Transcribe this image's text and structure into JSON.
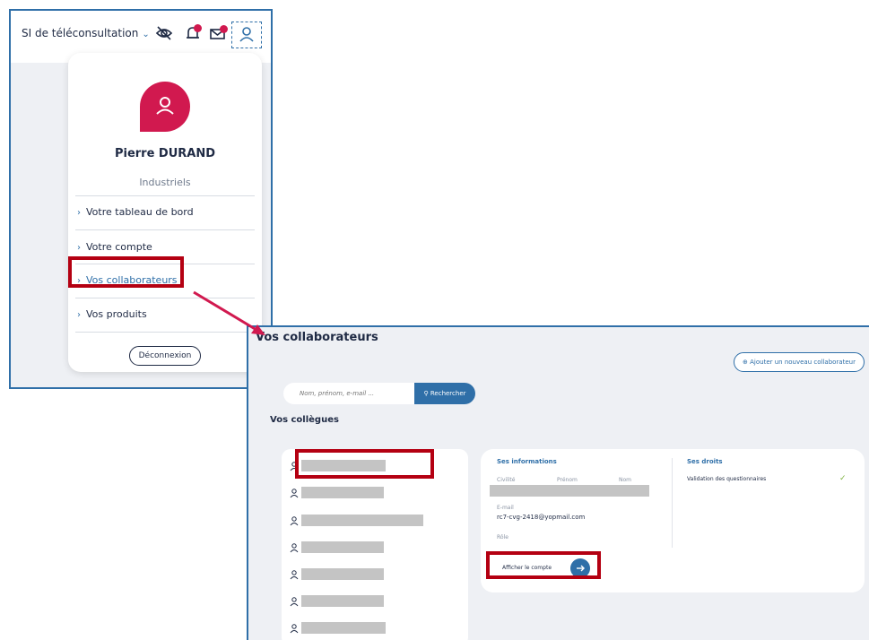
{
  "header": {
    "app_title": "SI de téléconsultation",
    "app_chevron": "⌄",
    "icons": [
      "eye-off-icon",
      "bell-icon",
      "mail-icon",
      "user-icon"
    ]
  },
  "user_menu": {
    "name": "Pierre DURAND",
    "organization": "Industriels",
    "items": [
      {
        "label": "Votre tableau de bord"
      },
      {
        "label": "Votre compte"
      },
      {
        "label": "Vos collaborateurs"
      },
      {
        "label": "Vos produits"
      }
    ],
    "logout_label": "Déconnexion"
  },
  "collaborators_page": {
    "title": "Vos collaborateurs",
    "add_button": "Ajouter un nouveau collaborateur",
    "search": {
      "placeholder": "Nom, prénom, e-mail ...",
      "button": "Rechercher"
    },
    "colleagues_title": "Vos collègues",
    "info": {
      "section_title": "Ses informations",
      "col_civilite": "Civilité",
      "col_prenom": "Prénom",
      "col_nom": "Nom",
      "email_label": "E-mail",
      "email_value": "rc7-cvg-2418@yopmail.com",
      "role_label": "Rôle",
      "show_account": "Afficher le compte"
    },
    "rights": {
      "title": "Ses droits",
      "item": "Validation des questionnaires"
    }
  },
  "colors": {
    "accent_blue": "#2f6fa8",
    "brand_pink": "#d1194f",
    "highlight_red": "#b40012"
  }
}
